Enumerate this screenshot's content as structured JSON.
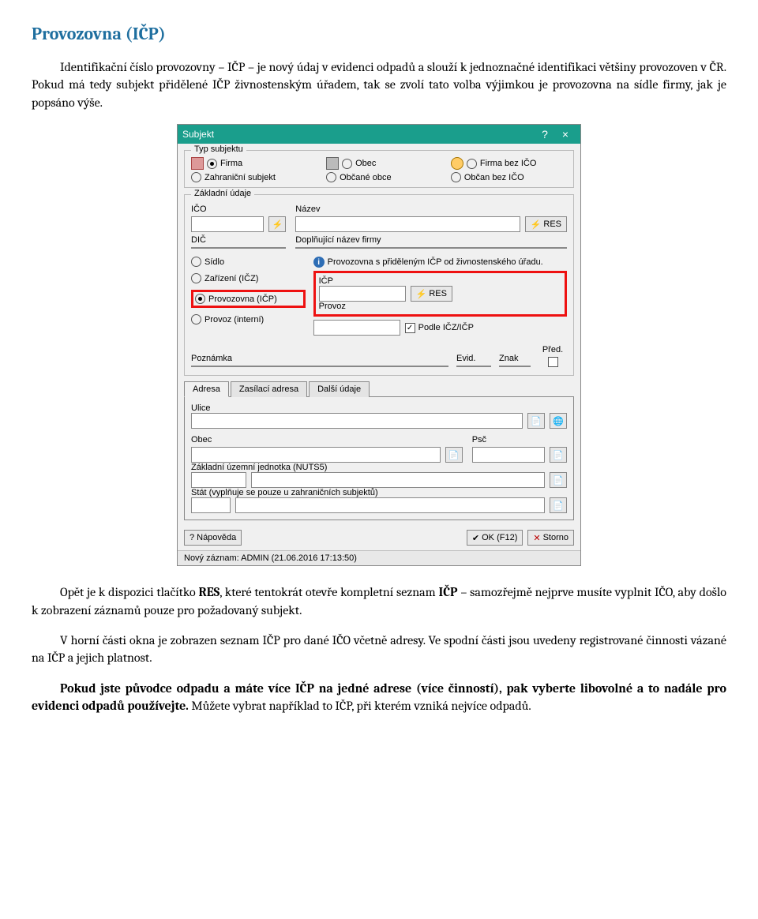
{
  "heading": "Provozovna (IČP)",
  "intro1_a": "Identifikační číslo provozovny – IČP – je nový údaj v evidenci odpadů a slouží k jednoznačné identifikaci většiny provozoven v ČR. Pokud má tedy subjekt přidělené IČP živnostenským úřadem, tak se zvolí tato volba výjimkou je provozovna na sídle firmy, jak je popsáno výše.",
  "dialog": {
    "title": "Subjekt",
    "help": "?",
    "close": "×",
    "grp_type": "Typ subjektu",
    "r_firma": "Firma",
    "r_zahr": "Zahraniční subjekt",
    "r_obec": "Obec",
    "r_obcane": "Občané obce",
    "r_firma_bez": "Firma bez IČO",
    "r_obcan_bez": "Občan bez IČO",
    "grp_zakl": "Základní údaje",
    "l_ico": "IČO",
    "l_nazev": "Název",
    "btn_res": "RES",
    "l_dic": "DIČ",
    "l_dopl": "Doplňující název firmy",
    "info_icp": "Provozovna s přiděleným IČP od živnostenského úřadu.",
    "r_sidlo": "Sídlo",
    "r_zarizeni": "Zařízení (IČZ)",
    "r_provozovna": "Provozovna (IČP)",
    "r_provoz_int": "Provoz (interní)",
    "l_icp": "IČP",
    "l_provoz": "Provoz",
    "chk_podle": "Podle IČZ/IČP",
    "l_poznamka": "Poznámka",
    "l_evid": "Evid.",
    "l_znak": "Znak",
    "l_pred": "Před.",
    "tab_adresa": "Adresa",
    "tab_zasil": "Zasílací adresa",
    "tab_dalsi": "Další údaje",
    "l_ulice": "Ulice",
    "l_obec2": "Obec",
    "l_psc": "Psč",
    "l_zuj": "Základní územní jednotka (NUTS5)",
    "l_stat": "Stát (vyplňuje se pouze u zahraničních subjektů)",
    "btn_napoveda": "Nápověda",
    "btn_ok": "OK (F12)",
    "btn_storno": "Storno",
    "status": "Nový záznam: ADMIN (21.06.2016 17:13:50)"
  },
  "p2_pre": "Opět je k dispozici tlačítko ",
  "p2_res": "RES",
  "p2_mid": ", které tentokrát otevře kompletní seznam ",
  "p2_icp": "IČP",
  "p2_post": " – samozřejmě nejprve musíte vyplnit IČO, aby došlo k zobrazení záznamů pouze pro požadovaný subjekt.",
  "p3": "V horní části okna je zobrazen seznam IČP pro dané IČO včetně adresy. Ve spodní části jsou uvedeny registrované činnosti vázané na IČP a jejich platnost.",
  "p4_b": "Pokud jste původce odpadu a máte více IČP na jedné adrese (více činností), pak vyberte libovolné a to nadále pro evidenci odpadů používejte.",
  "p4_rest": " Můžete vybrat například to IČP, při kterém vzniká nejvíce odpadů."
}
